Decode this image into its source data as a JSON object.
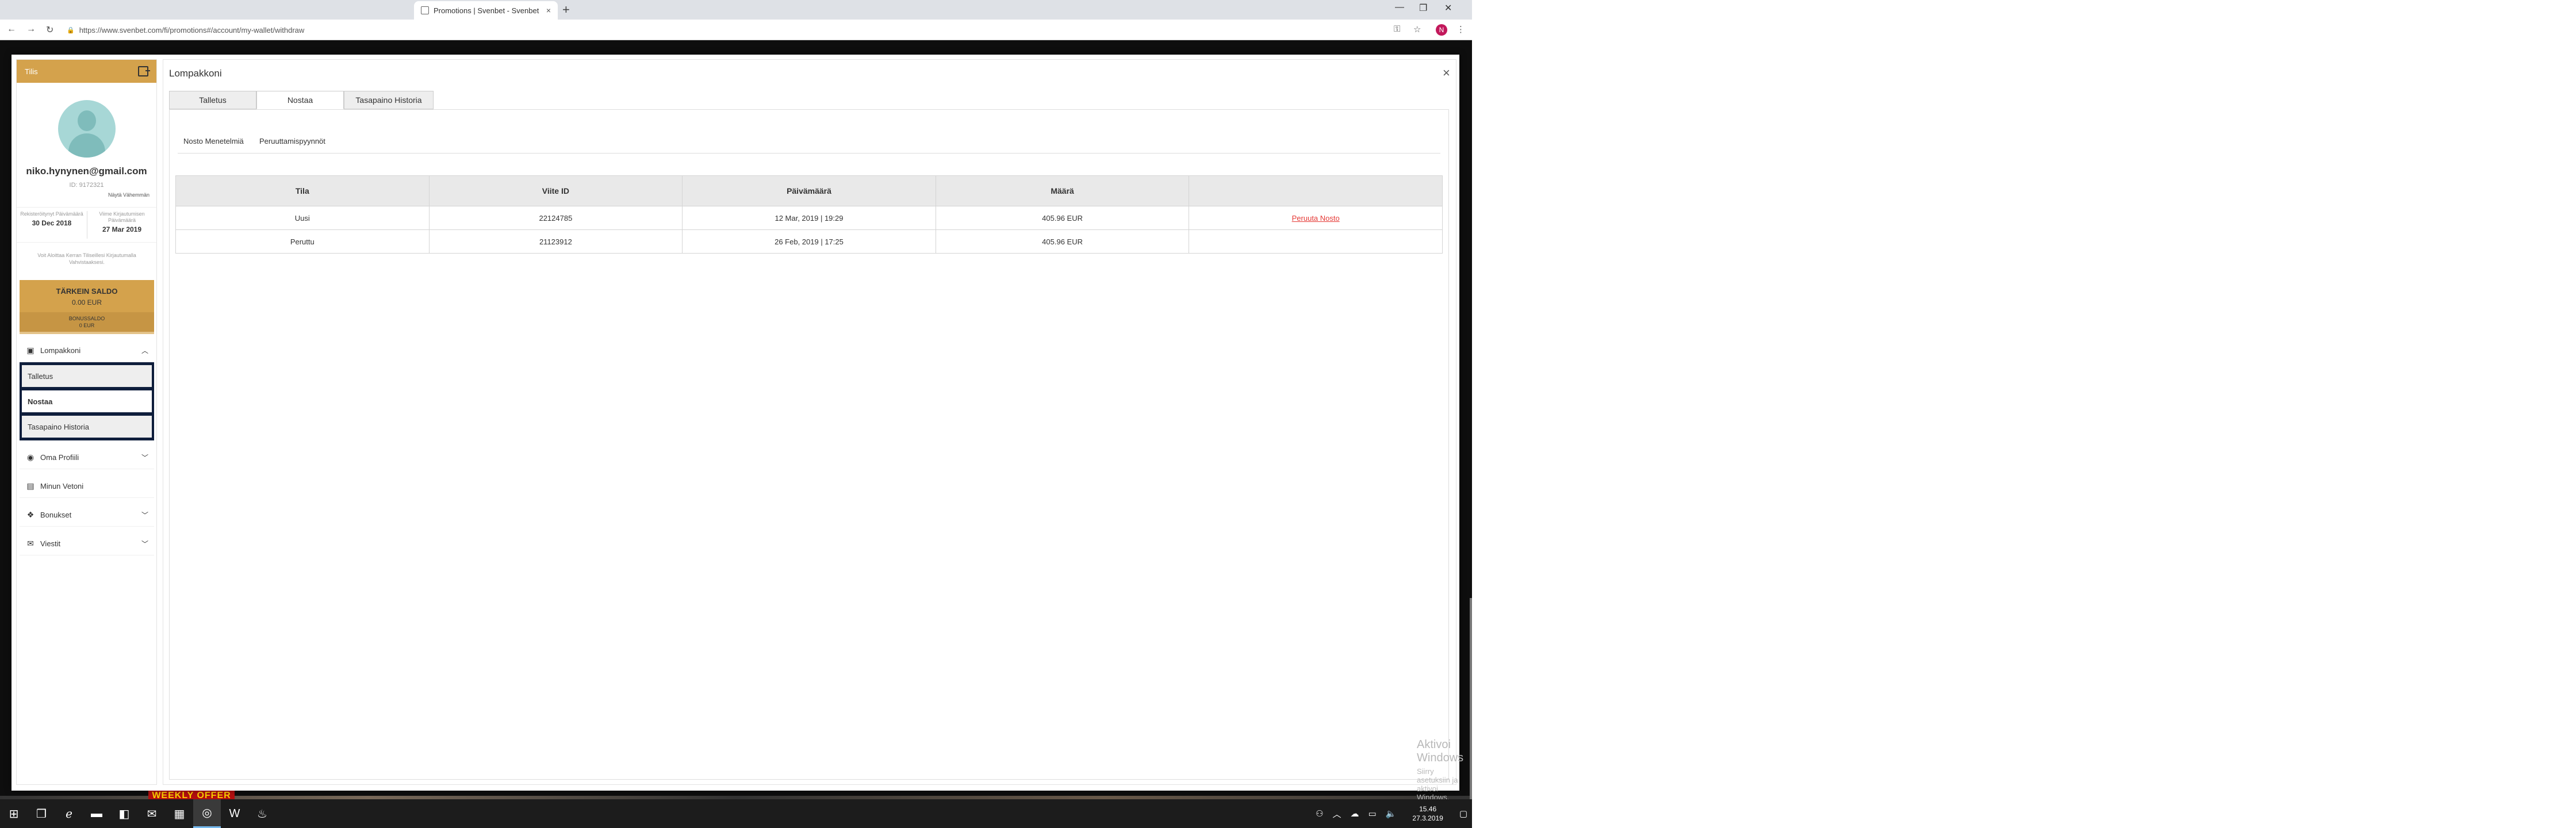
{
  "browser": {
    "tab_title": "Promotions | Svenbet - Svenbet",
    "tab_close": "×",
    "new_tab": "+",
    "url": "https://www.svenbet.com/fi/promotions#/account/my-wallet/withdraw",
    "profile_initial": "N"
  },
  "modal": {
    "sidebar": {
      "header_label": "Tilis",
      "email": "niko.hynynen@gmail.com",
      "user_id": "ID: 9172321",
      "show_more": "Näytä Vähemmän",
      "registered_label": "Rekisteröitynyt Päivämäärä",
      "registered_value": "30 Dec 2018",
      "last_login_label": "Viime Kirjautumisen Päivämäärä",
      "last_login_value": "27 Mar 2019",
      "verify_text": "Voit Aloittaa Kerran Tiliseillesi Kirjautumalla Vahvistaaksesi.",
      "main_balance_title": "TÄRKEIN SALDO",
      "main_balance_value": "0.00 EUR",
      "bonus_balance_title": "BONUSSALDO",
      "bonus_balance_value": "0 EUR",
      "menu": {
        "wallet": "Lompakkoni",
        "wallet_sub": [
          "Talletus",
          "Nostaa",
          "Tasapaino Historia"
        ],
        "profile": "Oma Profiili",
        "bets": "Minun Vetoni",
        "bonuses": "Bonukset",
        "messages": "Viestit"
      }
    },
    "title": "Lompakkoni",
    "close": "×",
    "tabs": [
      "Talletus",
      "Nostaa",
      "Tasapaino Historia"
    ],
    "active_tab": "Nostaa",
    "subtabs": [
      "Nosto Menetelmiä",
      "Peruuttamispyynnöt"
    ],
    "table": {
      "headers": [
        "Tila",
        "Viite ID",
        "Päivämäärä",
        "Määrä",
        ""
      ],
      "rows": [
        [
          "Uusi",
          "22124785",
          "12 Mar, 2019 | 19:29",
          "405.96 EUR",
          "Peruuta Nosto"
        ],
        [
          "Peruttu",
          "21123912",
          "26 Feb, 2019 | 17:25",
          "405.96 EUR",
          ""
        ]
      ]
    }
  },
  "background": {
    "weekly_offer": "WEEKLY OFFER"
  },
  "windows": {
    "activate_title": "Aktivoi Windows",
    "activate_sub": "Siirry asetuksiin ja aktivoi Windows.",
    "time": "15.46",
    "date": "27.3.2019"
  },
  "colors": {
    "gold": "#d4a24c",
    "navy": "#0f1e3c",
    "link_red": "#e53935"
  }
}
